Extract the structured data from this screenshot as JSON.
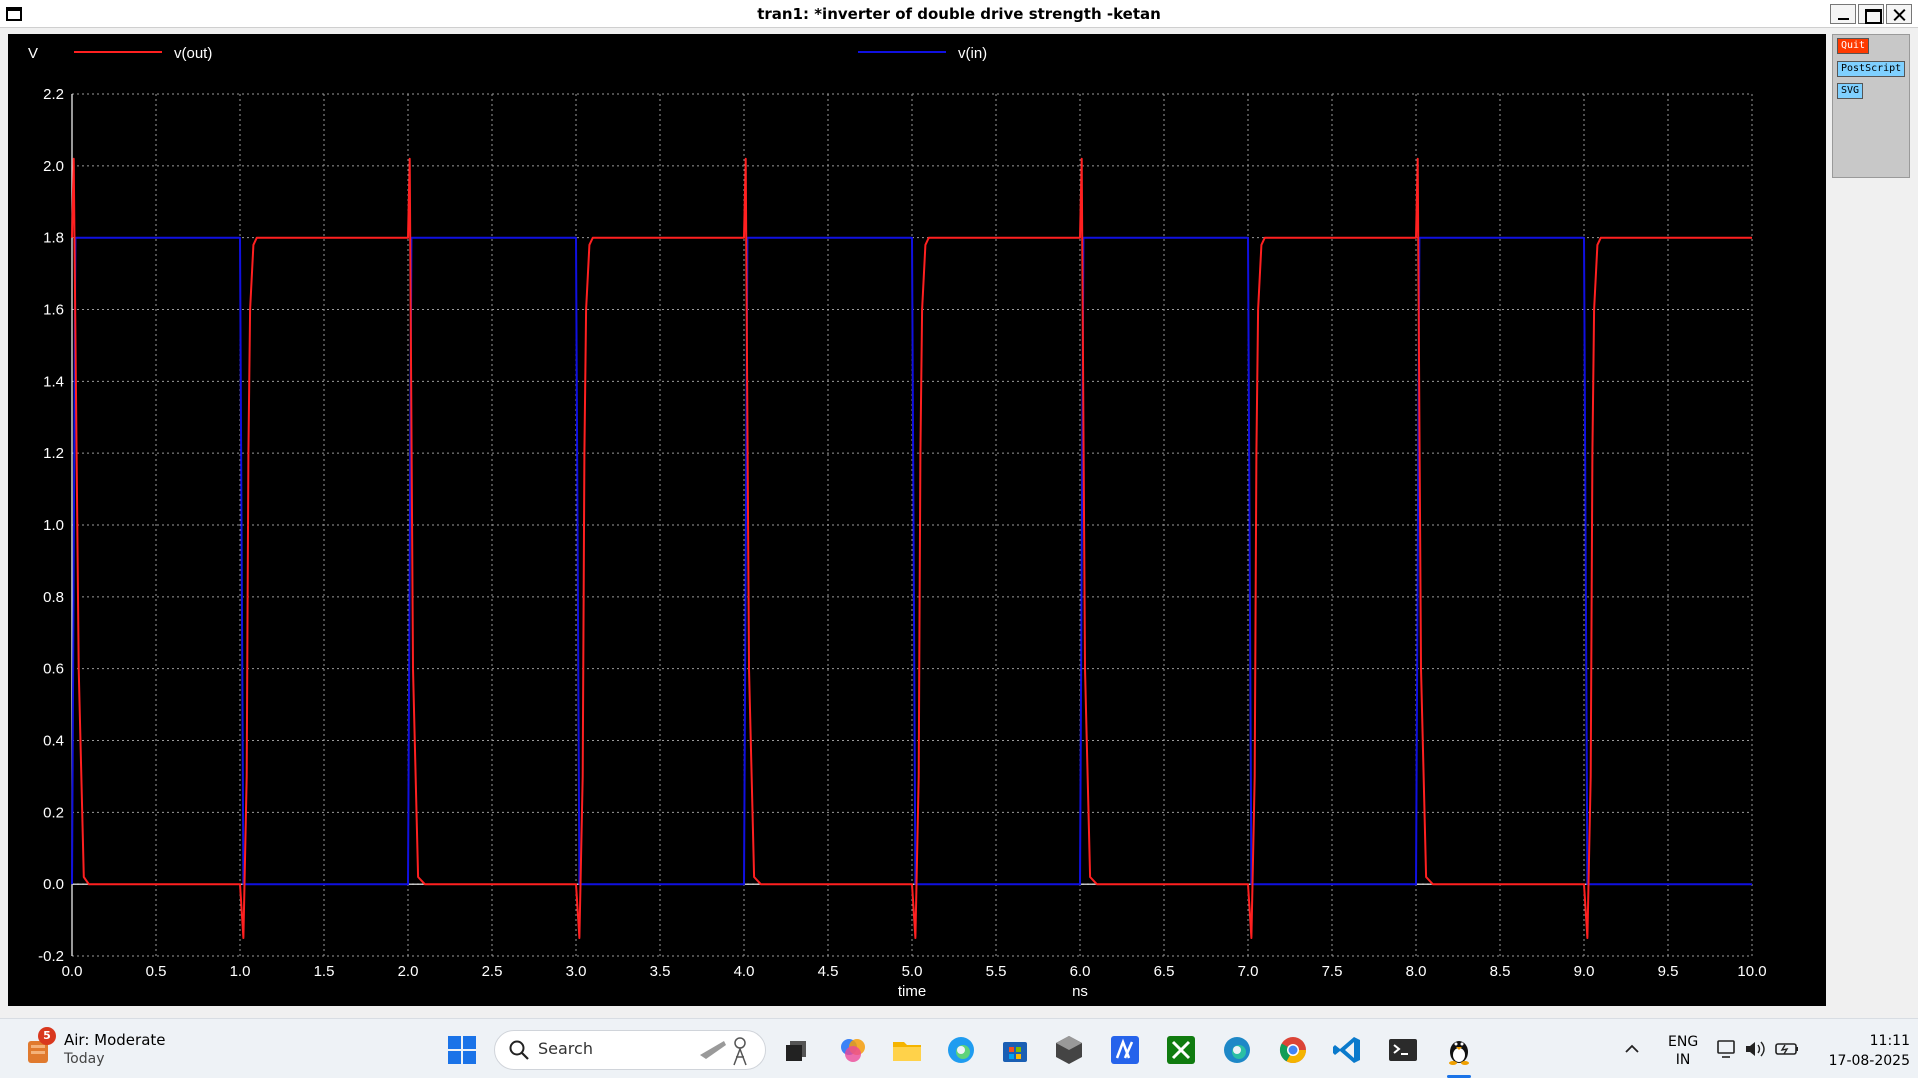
{
  "window": {
    "title": "tran1: *inverter of double drive strength -ketan"
  },
  "plot": {
    "yunit": "V",
    "legend": [
      {
        "name": "v(out)",
        "color": "#ff2020"
      },
      {
        "name": "v(in)",
        "color": "#1010e0"
      }
    ],
    "xlabel": "time",
    "xunit": "ns"
  },
  "chart_data": {
    "type": "line",
    "title": "",
    "xlabel": "time",
    "xunit": "ns",
    "ylabel": "V",
    "xlim": [
      0,
      10
    ],
    "ylim": [
      -0.2,
      2.2
    ],
    "x_ticks": [
      "0.0",
      "0.5",
      "1.0",
      "1.5",
      "2.0",
      "2.5",
      "3.0",
      "3.5",
      "4.0",
      "4.5",
      "5.0",
      "5.5",
      "6.0",
      "6.5",
      "7.0",
      "7.5",
      "8.0",
      "8.5",
      "9.0",
      "9.5",
      "10.0"
    ],
    "y_ticks": [
      "-0.2",
      "0.0",
      "0.2",
      "0.4",
      "0.6",
      "0.8",
      "1.0",
      "1.2",
      "1.4",
      "1.6",
      "1.8",
      "2.0",
      "2.2"
    ],
    "grid": true,
    "background": "#000000",
    "legend_position": "top",
    "series": [
      {
        "name": "v(in)",
        "color": "#1010e0",
        "x": [
          0.0,
          0.02,
          1.0,
          1.02,
          2.0,
          2.02,
          3.0,
          3.02,
          4.0,
          4.02,
          5.0,
          5.02,
          6.0,
          6.02,
          7.0,
          7.02,
          8.0,
          8.02,
          9.0,
          9.02,
          10.0
        ],
        "y": [
          0.0,
          1.8,
          1.8,
          0.0,
          0.0,
          1.8,
          1.8,
          0.0,
          0.0,
          1.8,
          1.8,
          0.0,
          0.0,
          1.8,
          1.8,
          0.0,
          0.0,
          1.8,
          1.8,
          0.0,
          0.0
        ]
      },
      {
        "name": "v(out)",
        "color": "#ff2020",
        "x": [
          0.0,
          0.01,
          0.04,
          0.07,
          0.1,
          1.0,
          1.02,
          1.04,
          1.05,
          1.06,
          1.08,
          1.1,
          2.0,
          2.01,
          2.03,
          2.06,
          2.1,
          3.0,
          3.02,
          3.04,
          3.05,
          3.06,
          3.08,
          3.1,
          4.0,
          4.01,
          4.03,
          4.06,
          4.1,
          5.0,
          5.02,
          5.04,
          5.05,
          5.06,
          5.08,
          5.1,
          6.0,
          6.01,
          6.03,
          6.06,
          6.1,
          7.0,
          7.02,
          7.04,
          7.05,
          7.06,
          7.08,
          7.1,
          8.0,
          8.01,
          8.03,
          8.06,
          8.1,
          9.0,
          9.02,
          9.04,
          9.05,
          9.06,
          9.08,
          9.1,
          10.0
        ],
        "y": [
          1.8,
          2.02,
          0.6,
          0.02,
          0.0,
          0.0,
          -0.15,
          0.3,
          1.2,
          1.6,
          1.78,
          1.8,
          1.8,
          2.02,
          0.6,
          0.02,
          0.0,
          0.0,
          -0.15,
          0.3,
          1.2,
          1.6,
          1.78,
          1.8,
          1.8,
          2.02,
          0.6,
          0.02,
          0.0,
          0.0,
          -0.15,
          0.3,
          1.2,
          1.6,
          1.78,
          1.8,
          1.8,
          2.02,
          0.6,
          0.02,
          0.0,
          0.0,
          -0.15,
          0.3,
          1.2,
          1.6,
          1.78,
          1.8,
          1.8,
          2.02,
          0.6,
          0.02,
          0.0,
          0.0,
          -0.15,
          0.3,
          1.2,
          1.6,
          1.78,
          1.8,
          1.8
        ]
      }
    ]
  },
  "side_buttons": {
    "quit": "Quit",
    "postscript": "PostScript",
    "svg": "SVG"
  },
  "taskbar": {
    "weather_badge": "5",
    "weather_title": "Air: Moderate",
    "weather_sub": "Today",
    "search_placeholder": "Search",
    "lang_line1": "ENG",
    "lang_line2": "IN",
    "time": "11:11",
    "date": "17-08-2025",
    "apps": [
      "file-explorer",
      "copilot",
      "folder",
      "edge",
      "store",
      "3d-viewer",
      "alacritty",
      "xbox",
      "edge-beta",
      "chrome",
      "vscode",
      "terminal",
      "tux"
    ]
  }
}
